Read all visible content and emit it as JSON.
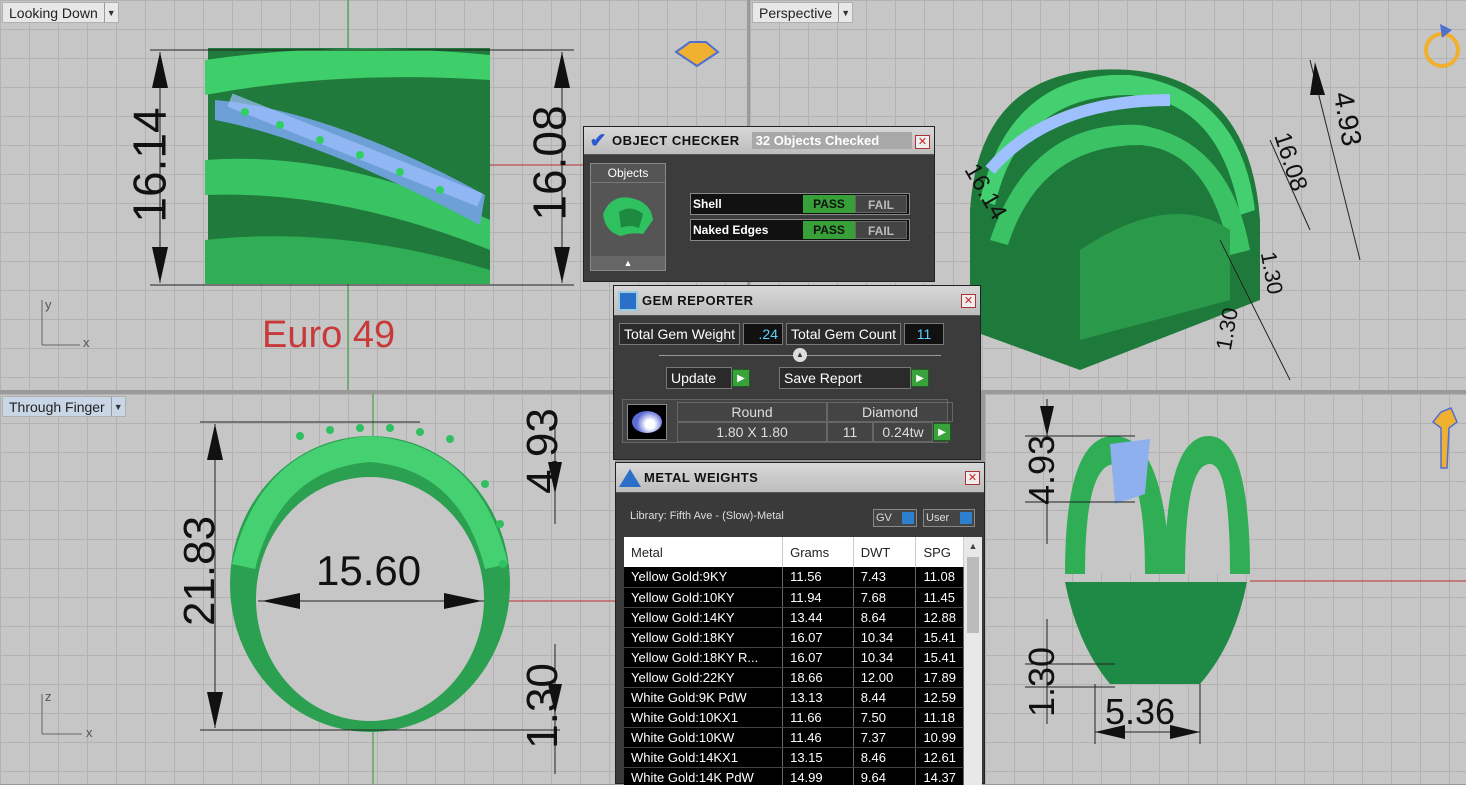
{
  "viewports": {
    "top_left": {
      "label": "Looking Down",
      "dims": [
        "16.14",
        "16.08"
      ],
      "size_text": "Euro 49",
      "axis_v": "y",
      "axis_h": "x"
    },
    "top_right": {
      "label": "Perspective",
      "dims": [
        "4.93",
        "16.08",
        "1.30",
        "1.30",
        "16.14"
      ]
    },
    "bottom_left": {
      "label": "Through Finger",
      "dims": [
        "21.83",
        "4.93",
        "15.60",
        "1.30"
      ],
      "axis_v": "z",
      "axis_h": "x"
    },
    "bottom_right": {
      "dims": [
        "4.93",
        "1.30",
        "5.36"
      ]
    }
  },
  "object_checker": {
    "title": "OBJECT CHECKER",
    "status": "32 Objects Checked",
    "objects_label": "Objects",
    "checks": [
      {
        "name": "Shell",
        "pass": "PASS",
        "fail": "FAIL"
      },
      {
        "name": "Naked Edges",
        "pass": "PASS",
        "fail": "FAIL"
      }
    ]
  },
  "gem_reporter": {
    "title": "GEM REPORTER",
    "total_weight_label": "Total Gem Weight",
    "total_weight": ".24",
    "total_count_label": "Total Gem Count",
    "total_count": "11",
    "update_label": "Update",
    "save_label": "Save Report",
    "gem": {
      "shape": "Round",
      "type": "Diamond",
      "size": "1.80 X 1.80",
      "count": "11",
      "weight": "0.24tw"
    }
  },
  "metal_weights": {
    "title": "METAL WEIGHTS",
    "library": "Library: Fifth Ave - (Slow)-Metal",
    "toggle1": "GV",
    "toggle2": "User",
    "columns": [
      "Metal",
      "Grams",
      "DWT",
      "SPG"
    ],
    "rows": [
      [
        "Yellow Gold:9KY",
        "11.56",
        "7.43",
        "11.08"
      ],
      [
        "Yellow Gold:10KY",
        "11.94",
        "7.68",
        "11.45"
      ],
      [
        "Yellow Gold:14KY",
        "13.44",
        "8.64",
        "12.88"
      ],
      [
        "Yellow Gold:18KY",
        "16.07",
        "10.34",
        "15.41"
      ],
      [
        "Yellow Gold:18KY R...",
        "16.07",
        "10.34",
        "15.41"
      ],
      [
        "Yellow Gold:22KY",
        "18.66",
        "12.00",
        "17.89"
      ],
      [
        "White Gold:9K PdW",
        "13.13",
        "8.44",
        "12.59"
      ],
      [
        "White Gold:10KX1",
        "11.66",
        "7.50",
        "11.18"
      ],
      [
        "White Gold:10KW",
        "11.46",
        "7.37",
        "10.99"
      ],
      [
        "White Gold:14KX1",
        "13.15",
        "8.46",
        "12.61"
      ],
      [
        "White Gold:14K PdW",
        "14.99",
        "9.64",
        "14.37"
      ]
    ]
  },
  "colors": {
    "ring_green": "#2fb85a",
    "gem_blue": "#9fb8f0",
    "panel_bg": "#3c3c3c",
    "pass_green": "#38a038"
  }
}
